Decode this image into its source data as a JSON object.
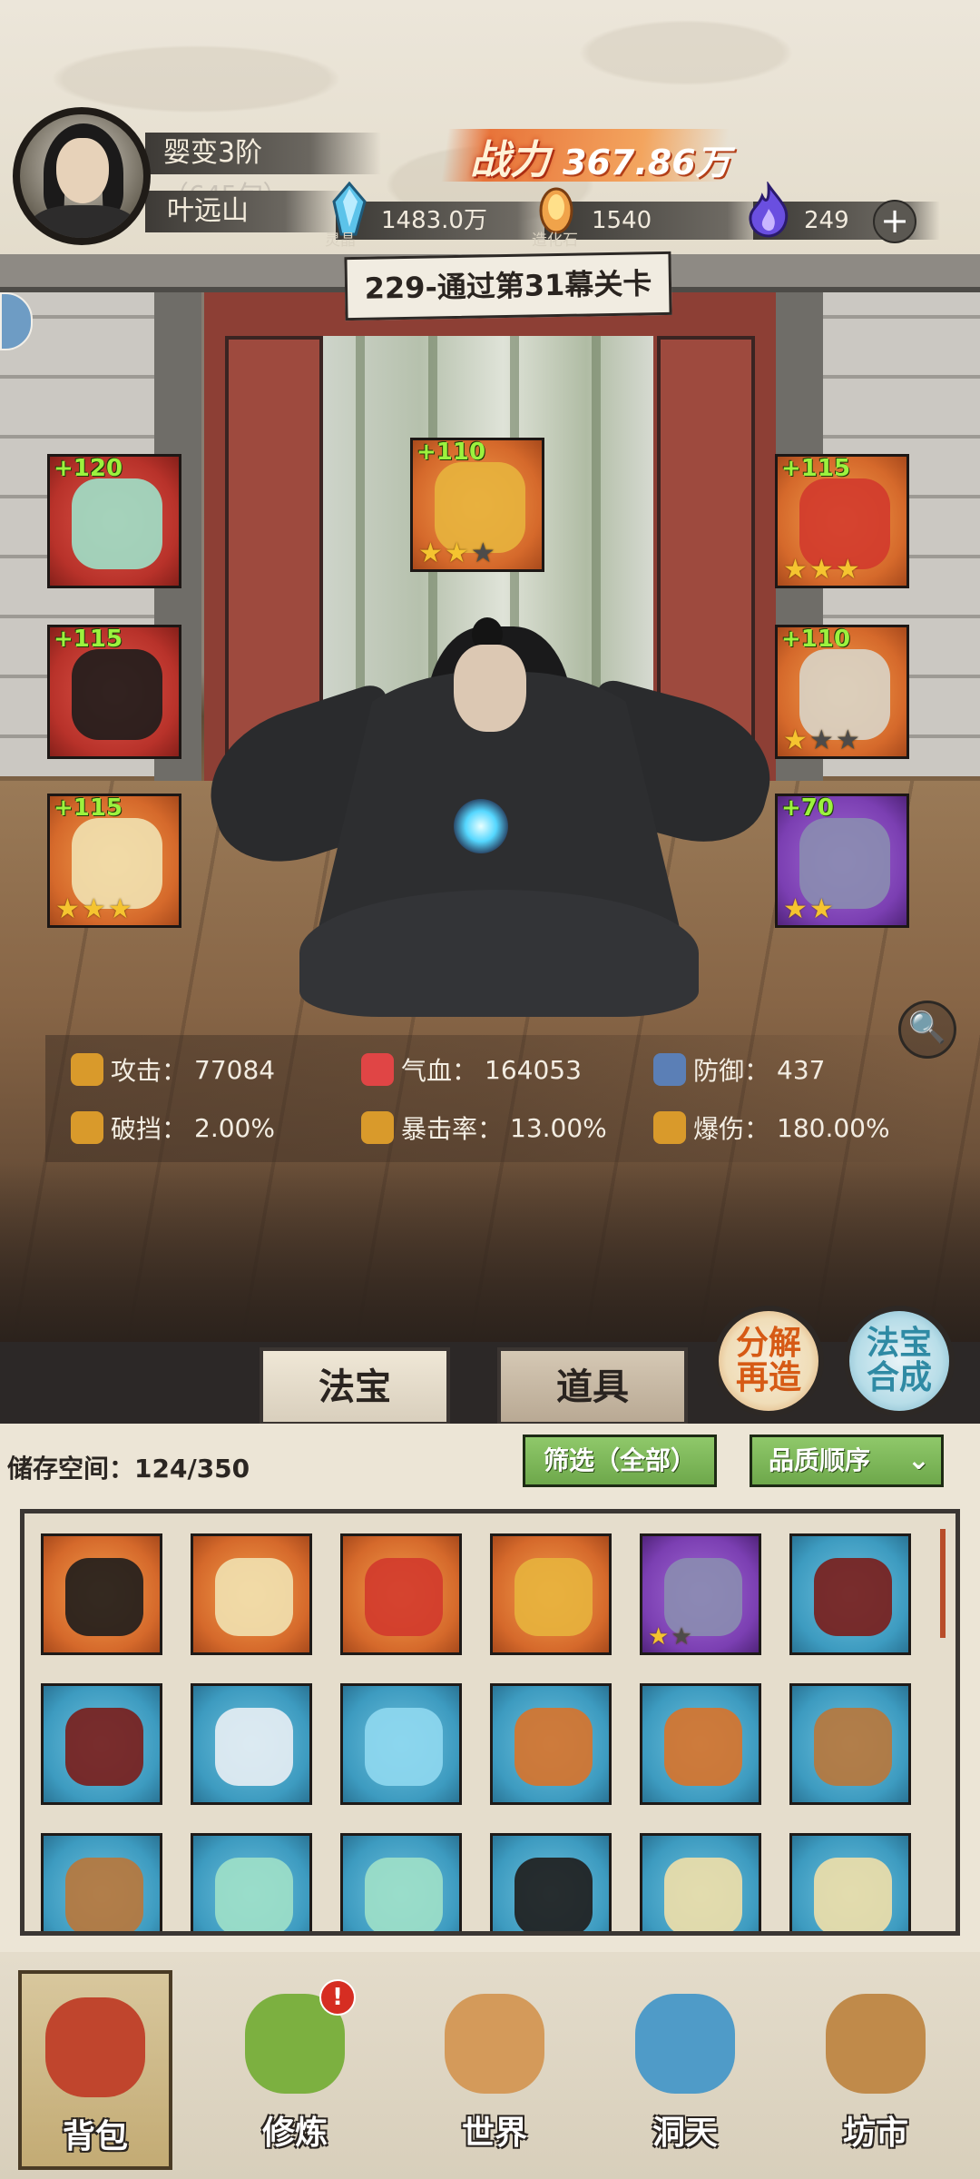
{
  "player": {
    "realm": "婴变3阶",
    "realm_progress": "（645旬）",
    "name": "叶远山"
  },
  "power": {
    "label": "战力",
    "value": "367.86万"
  },
  "resources": [
    {
      "icon": "spirit-crystal-icon",
      "caption": "灵晶",
      "value": "1483.0万"
    },
    {
      "icon": "creation-stone-icon",
      "caption": "造化石",
      "value": "1540"
    },
    {
      "icon": "purple-flame-icon",
      "caption": "",
      "value": "249"
    }
  ],
  "stage": {
    "title": "229-通过第31幕关卡"
  },
  "equipment": [
    {
      "slot": "fan",
      "plus": "+120",
      "color": "red",
      "stars": 0,
      "max_stars": 0
    },
    {
      "slot": "golden-beast",
      "plus": "+110",
      "color": "orange",
      "stars": 2,
      "max_stars": 3
    },
    {
      "slot": "crown",
      "plus": "+115",
      "color": "orange",
      "stars": 3,
      "max_stars": 3
    },
    {
      "slot": "robe",
      "plus": "+115",
      "color": "red",
      "stars": 0,
      "max_stars": 0
    },
    {
      "slot": "pendant",
      "plus": "+110",
      "color": "orange",
      "stars": 1,
      "max_stars": 3
    },
    {
      "slot": "boots",
      "plus": "+115",
      "color": "orange",
      "stars": 3,
      "max_stars": 3
    },
    {
      "slot": "ring",
      "plus": "+70",
      "color": "purple",
      "stars": 2,
      "max_stars": 2
    }
  ],
  "stats": [
    {
      "icon": "sword-icon",
      "label": "攻击：",
      "value": "77084"
    },
    {
      "icon": "heart-icon",
      "label": "气血：",
      "value": "164053"
    },
    {
      "icon": "shield-icon",
      "label": "防御：",
      "value": "437"
    },
    {
      "icon": "break-icon",
      "label": "破挡：",
      "value": "2.00%"
    },
    {
      "icon": "crit-icon",
      "label": "暴击率：",
      "value": "13.00%"
    },
    {
      "icon": "crit-damage-icon",
      "label": "爆伤：",
      "value": "180.00%"
    }
  ],
  "tabs": {
    "treasure": "法宝",
    "items": "道具"
  },
  "actions": {
    "decompose": [
      "分解",
      "再造"
    ],
    "synthesize": [
      "法宝",
      "合成"
    ]
  },
  "inventory": {
    "storage_label": "储存空间：",
    "storage_value": "124/350",
    "filter_label": "筛选（全部）",
    "sort_label": "品质顺序",
    "items": [
      {
        "name": "robe",
        "color": "orange",
        "stars": 0
      },
      {
        "name": "boots",
        "color": "orange",
        "stars": 0
      },
      {
        "name": "crown",
        "color": "orange",
        "stars": 0
      },
      {
        "name": "golden-beast",
        "color": "orange",
        "stars": 0
      },
      {
        "name": "ring",
        "color": "purple",
        "stars": 1,
        "max_stars": 2
      },
      {
        "name": "dagger",
        "color": "blue",
        "stars": 0
      },
      {
        "name": "dagger",
        "color": "blue",
        "stars": 0
      },
      {
        "name": "whisk",
        "color": "blue",
        "stars": 0
      },
      {
        "name": "bow",
        "color": "blue",
        "stars": 0
      },
      {
        "name": "axe",
        "color": "blue",
        "stars": 0
      },
      {
        "name": "axe",
        "color": "blue",
        "stars": 0
      },
      {
        "name": "staff",
        "color": "blue",
        "stars": 0
      },
      {
        "name": "staff",
        "color": "blue",
        "stars": 0
      },
      {
        "name": "fan",
        "color": "blue",
        "stars": 0
      },
      {
        "name": "fan",
        "color": "blue",
        "stars": 0
      },
      {
        "name": "robe",
        "color": "blue",
        "stars": 0
      },
      {
        "name": "armor",
        "color": "blue",
        "stars": 0
      },
      {
        "name": "armor",
        "color": "blue",
        "stars": 0
      }
    ]
  },
  "nav": [
    {
      "label": "背包",
      "icon": "bag-icon",
      "active": true
    },
    {
      "label": "修炼",
      "icon": "lotus-icon",
      "badge": "!"
    },
    {
      "label": "世界",
      "icon": "scroll-icon"
    },
    {
      "label": "洞天",
      "icon": "portal-icon"
    },
    {
      "label": "坊市",
      "icon": "market-icon"
    }
  ]
}
